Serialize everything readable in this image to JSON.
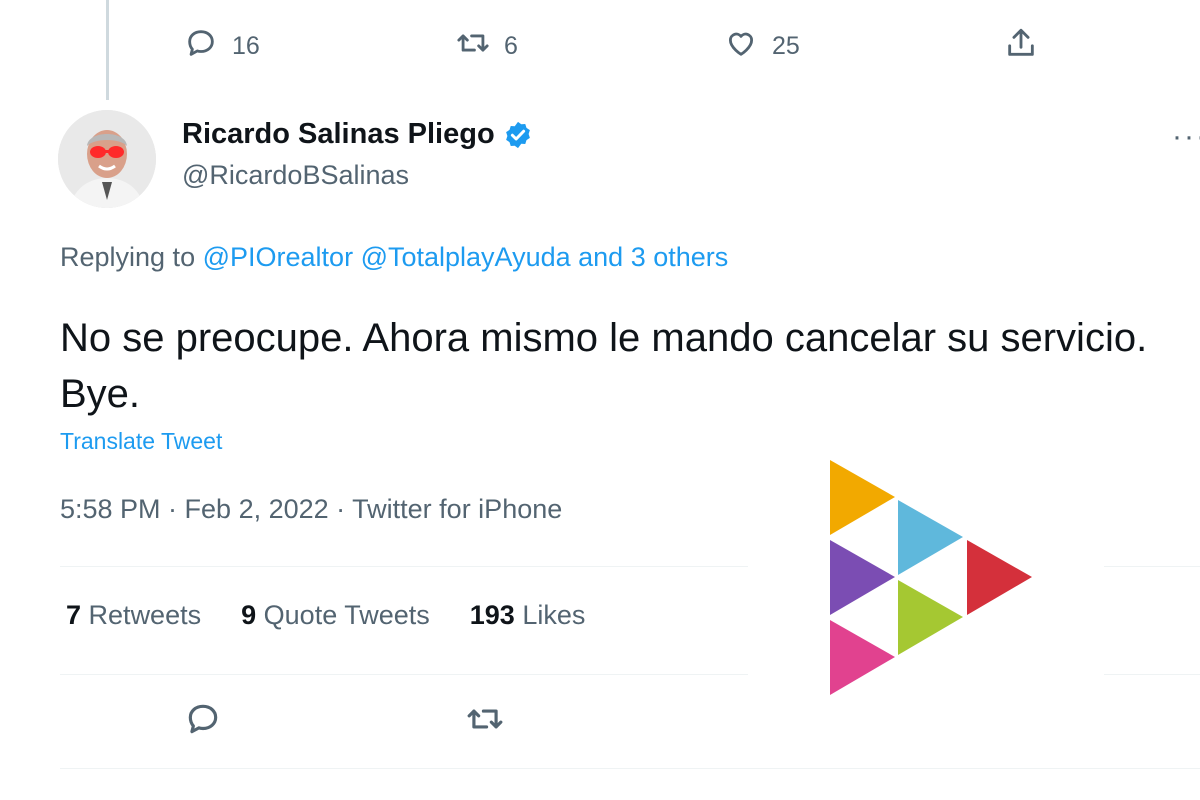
{
  "top_actions": {
    "reply_count": "16",
    "retweet_count": "6",
    "like_count": "25"
  },
  "tweet": {
    "author_name": "Ricardo Salinas Pliego",
    "author_handle": "@RicardoBSalinas",
    "more_label": "···",
    "replying_prefix": "Replying to",
    "replying_user_1": "@PIOrealtor",
    "replying_user_2": "@TotalplayAyuda",
    "replying_others": "and 3 others",
    "text": "No se preocupe. Ahora mismo le mando cancelar su servicio. Bye.",
    "translate_label": "Translate Tweet",
    "timestamp": "5:58 PM · Feb 2, 2022 · Twitter for iPhone"
  },
  "stats": {
    "retweets_count": "7",
    "retweets_label": "Retweets",
    "quotes_count": "9",
    "quotes_label": "Quote Tweets",
    "likes_count": "193",
    "likes_label": "Likes"
  },
  "icons": {
    "reply": "reply-icon",
    "retweet": "retweet-icon",
    "like": "heart-icon",
    "share": "share-icon",
    "verified": "verified-badge-icon",
    "watermark": "triangles-logo"
  },
  "colors": {
    "link": "#1d9bf0",
    "secondary_text": "#536471",
    "primary_text": "#0f1419",
    "verified": "#1d9bf0"
  }
}
